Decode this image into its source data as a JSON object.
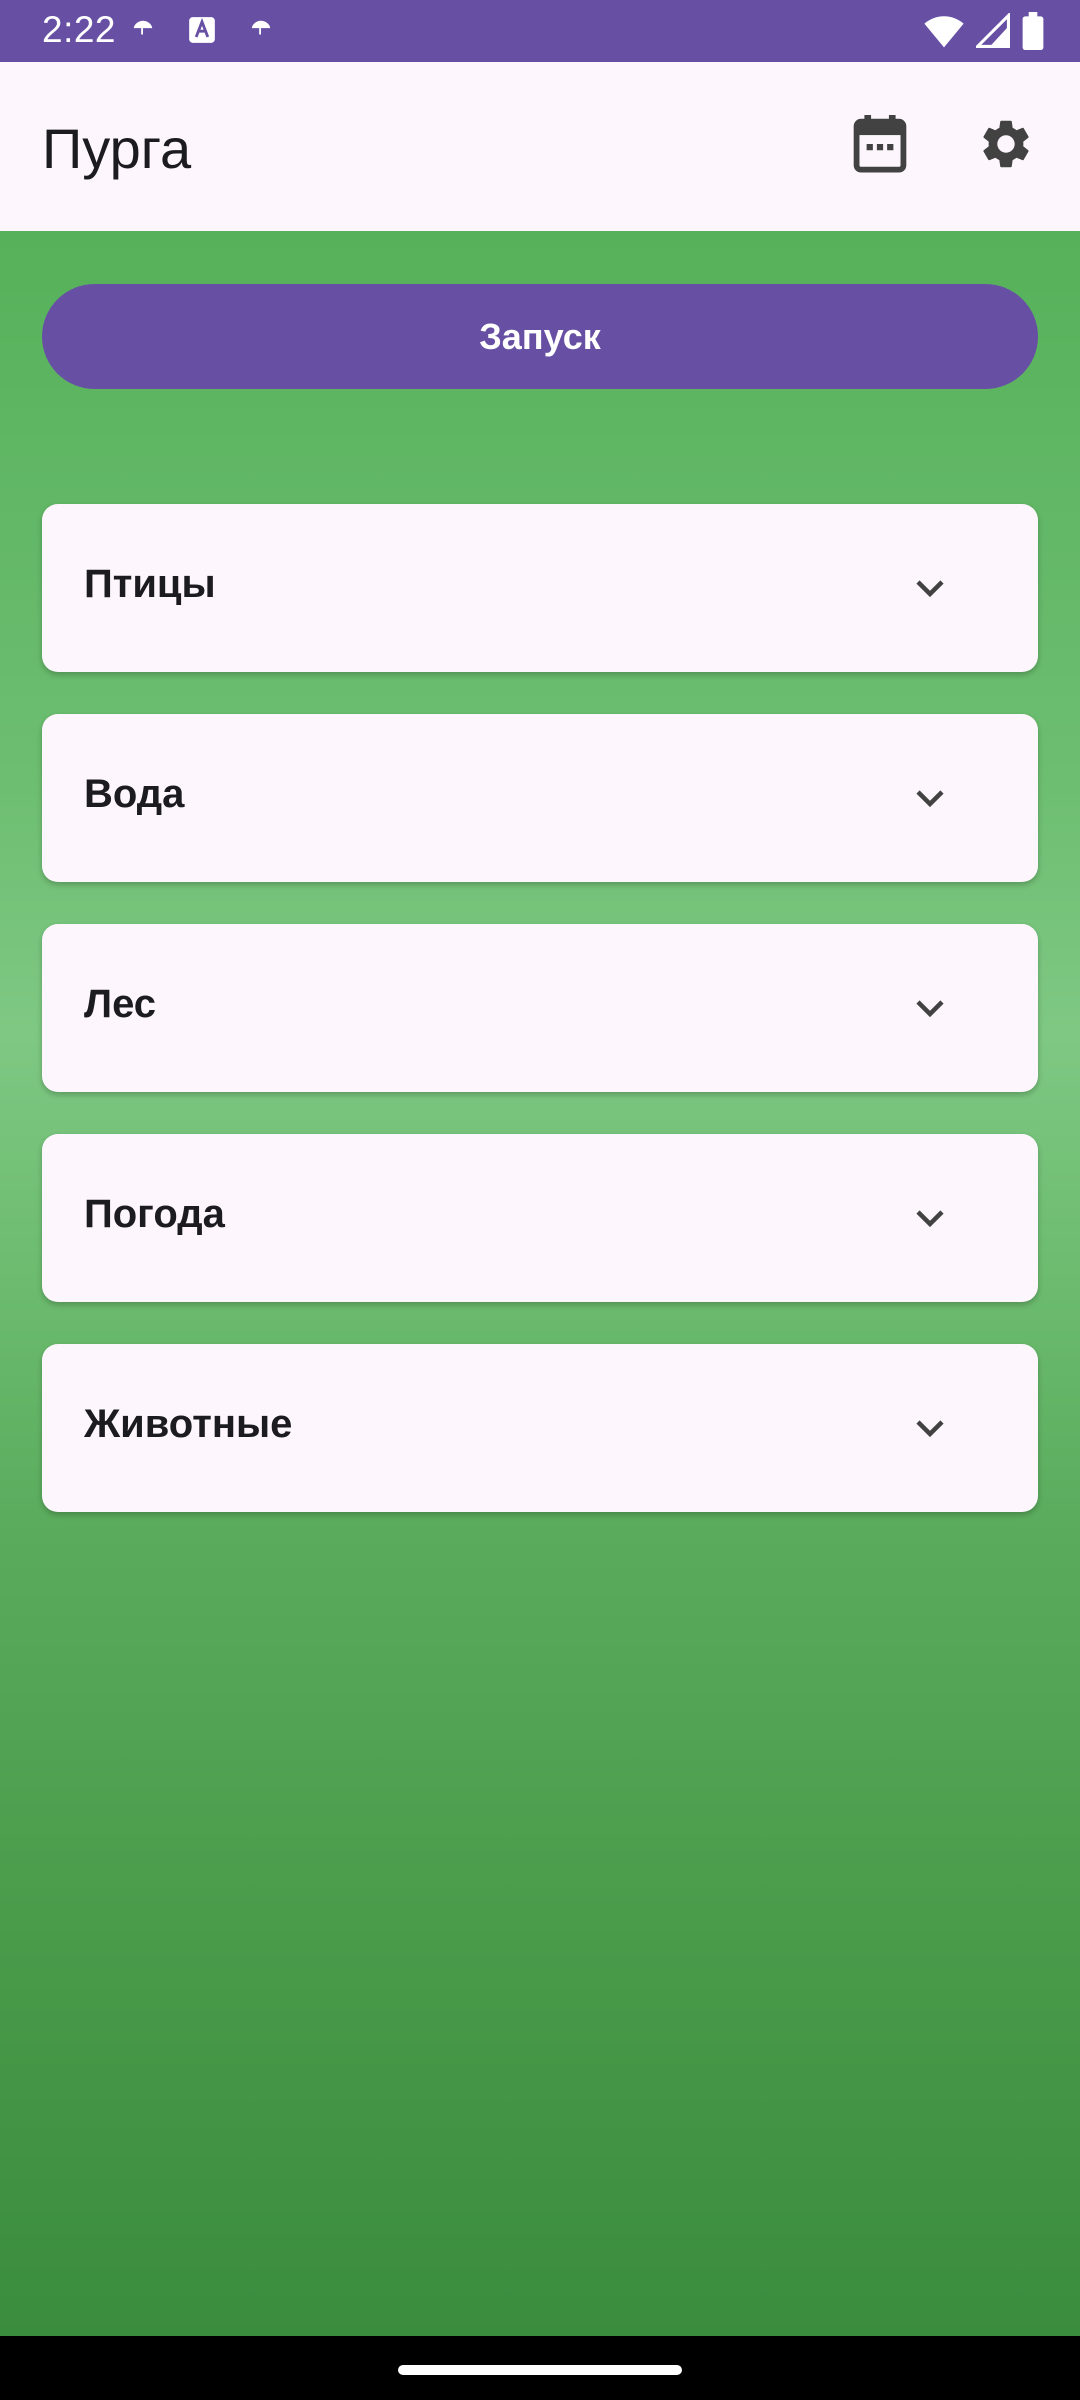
{
  "status_bar": {
    "time": "2:22",
    "notifications": [
      "umbrella-icon",
      "text-a-icon",
      "umbrella-icon"
    ],
    "system_icons": [
      "wifi-icon",
      "signal-icon",
      "battery-icon"
    ]
  },
  "app_bar": {
    "title": "Пурга",
    "actions": [
      "calendar-icon",
      "gear-icon"
    ]
  },
  "main": {
    "launch_label": "Запуск",
    "categories": [
      {
        "label": "Птицы"
      },
      {
        "label": "Вода"
      },
      {
        "label": "Лес"
      },
      {
        "label": "Погода"
      },
      {
        "label": "Животные"
      }
    ]
  },
  "colors": {
    "primary": "#6750a4",
    "surface": "#fdf7fd",
    "background_green": "#5aab5c"
  }
}
